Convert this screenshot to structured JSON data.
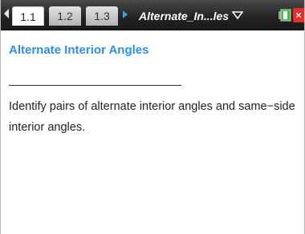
{
  "tabs": [
    {
      "label": "1.1",
      "active": true
    },
    {
      "label": "1.2",
      "active": false
    },
    {
      "label": "1.3",
      "active": false
    }
  ],
  "document": {
    "title": "Alternate_In...les"
  },
  "icons": {
    "prev_page": "triangle-left-icon",
    "next_page": "triangle-right-icon",
    "dropdown": "chevron-down-icon",
    "battery": "battery-icon",
    "close": "close-icon"
  },
  "colors": {
    "heading": "#2f8fe0",
    "topbar": "#222222",
    "next_arrow": "#3aa0e8",
    "close": "#e03030",
    "battery": "#3cc03c"
  },
  "page": {
    "heading": "Alternate Interior Angles",
    "body": "Identify pairs of alternate interior angles and same−side interior angles."
  }
}
